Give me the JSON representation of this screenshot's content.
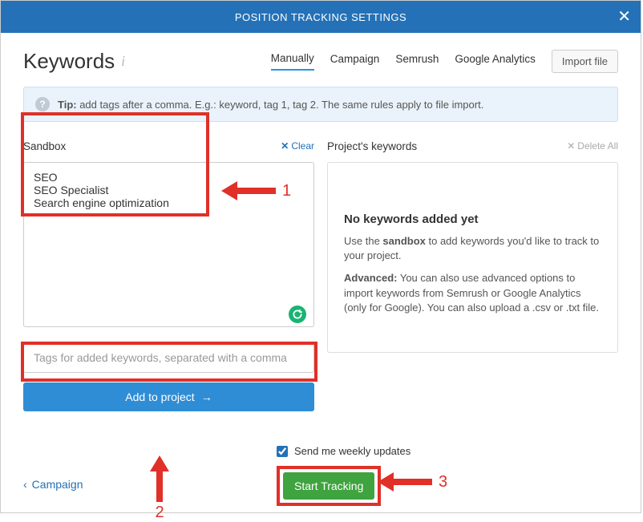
{
  "titlebar": "POSITION TRACKING SETTINGS",
  "page_title": "Keywords",
  "tabs": {
    "manually": "Manually",
    "campaign": "Campaign",
    "semrush": "Semrush",
    "ga": "Google Analytics"
  },
  "import_label": "Import file",
  "tip_label": "Tip:",
  "tip_text": " add tags after a comma. E.g.: keyword, tag 1, tag 2. The same rules apply to file import.",
  "sandbox": {
    "title": "Sandbox",
    "clear": "Clear",
    "text": "SEO\nSEO Specialist\nSearch engine optimization",
    "tags_placeholder": "Tags for added keywords, separated with a comma",
    "add_label": "Add to project"
  },
  "project": {
    "title": "Project's keywords",
    "delete_all": "Delete All",
    "empty_h": "No keywords added yet",
    "empty_p1a": "Use the ",
    "empty_p1b": "sandbox",
    "empty_p1c": " to add keywords you'd like to track to your project.",
    "empty_p2a": "Advanced:",
    "empty_p2b": " You can also use advanced options to import keywords from Semrush or Google Analytics (only for Google). You can also upload a .csv or .txt file."
  },
  "footer": {
    "back": "Campaign",
    "weekly": "Send me weekly updates",
    "start": "Start Tracking"
  },
  "annot": {
    "n1": "1",
    "n2": "2",
    "n3": "3"
  }
}
